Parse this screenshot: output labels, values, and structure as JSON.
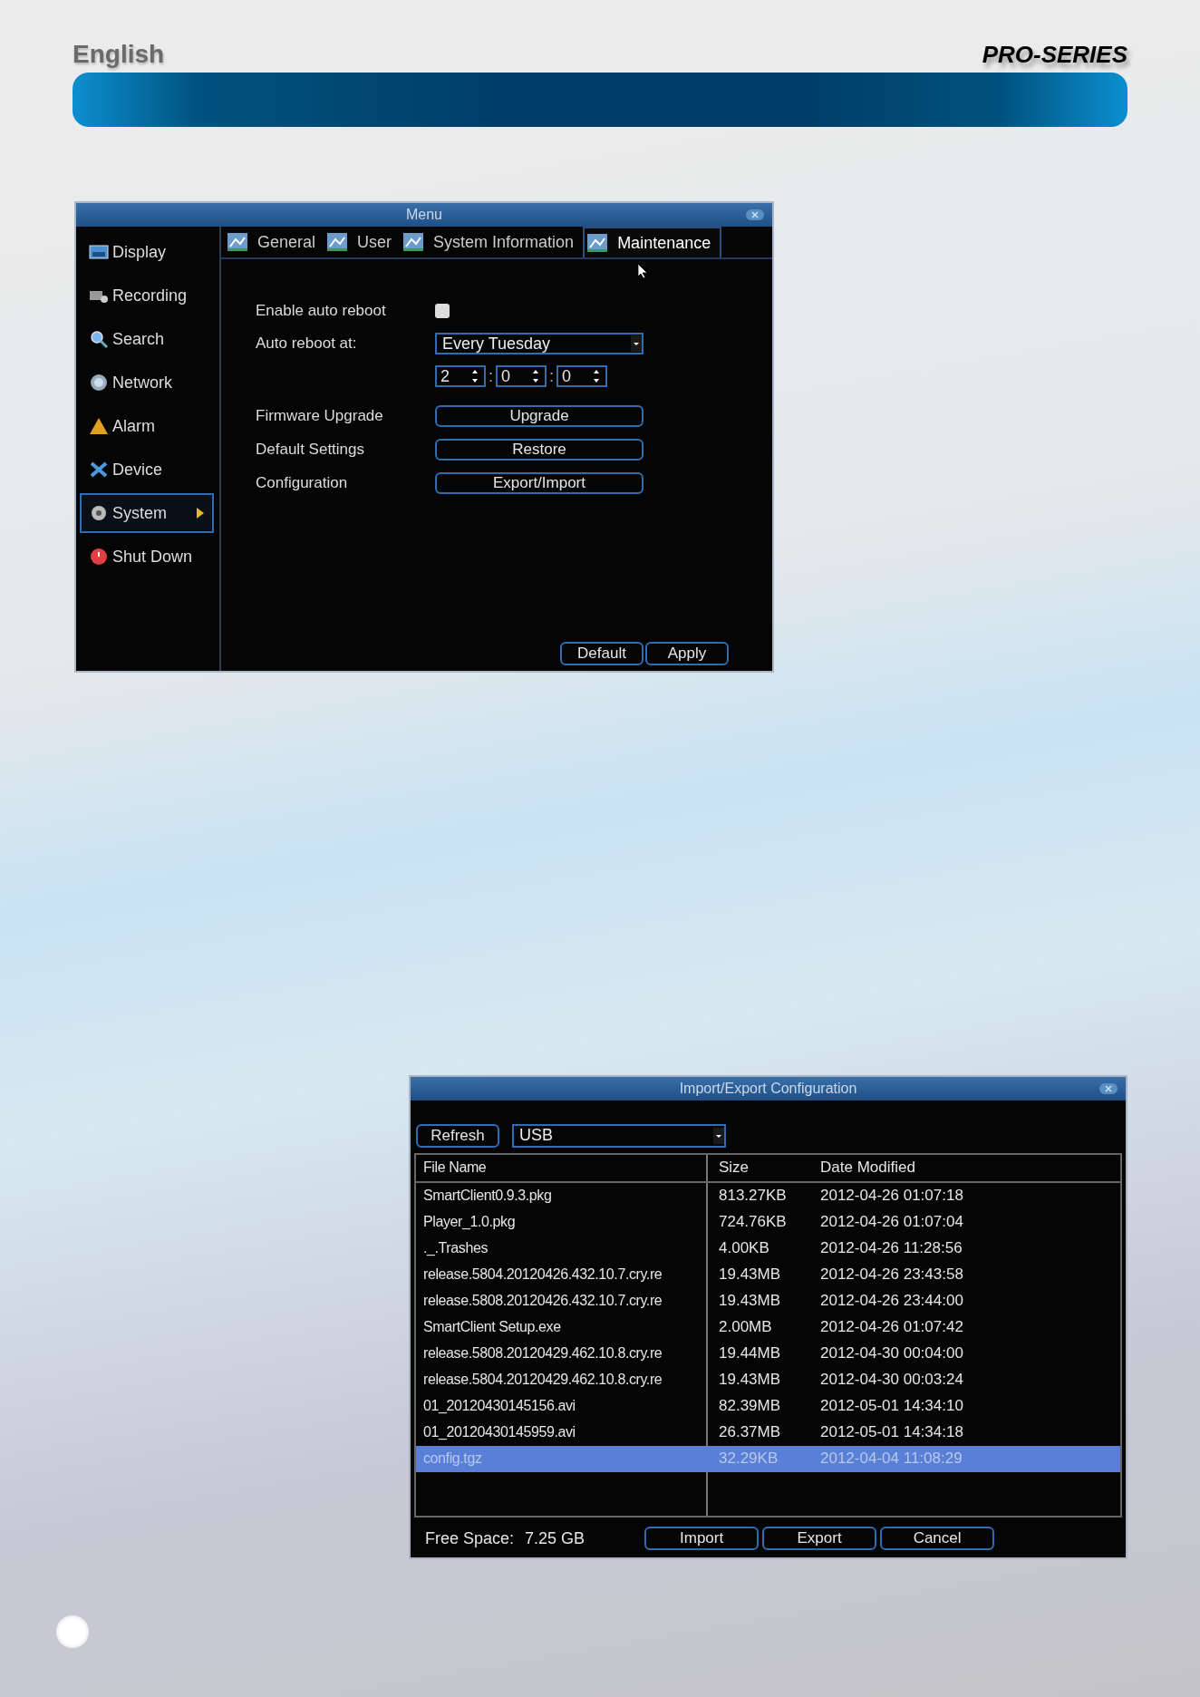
{
  "page_header": {
    "language": "English",
    "brand": "PRO-SERIES"
  },
  "menu_window": {
    "title": "Menu",
    "sidebar": [
      {
        "label": "Display",
        "selected": false
      },
      {
        "label": "Recording",
        "selected": false
      },
      {
        "label": "Search",
        "selected": false
      },
      {
        "label": "Network",
        "selected": false
      },
      {
        "label": "Alarm",
        "selected": false
      },
      {
        "label": "Device",
        "selected": false
      },
      {
        "label": "System",
        "selected": true
      },
      {
        "label": "Shut Down",
        "selected": false
      }
    ],
    "tabs": [
      {
        "label": "General",
        "selected": false
      },
      {
        "label": "User",
        "selected": false
      },
      {
        "label": "System Information",
        "selected": false
      },
      {
        "label": "Maintenance",
        "selected": true
      }
    ],
    "enable_auto_reboot": {
      "label": "Enable auto reboot",
      "checked": false
    },
    "auto_reboot_at": {
      "label": "Auto reboot at:",
      "value": "Every Tuesday",
      "time": [
        "2",
        "0",
        "0"
      ],
      "separator": ":"
    },
    "actions": [
      {
        "label": "Firmware Upgrade",
        "button": "Upgrade"
      },
      {
        "label": "Default Settings",
        "button": "Restore"
      },
      {
        "label": "Configuration",
        "button": "Export/Import"
      }
    ],
    "buttons": [
      "Default",
      "Apply"
    ]
  },
  "import_export_dialog": {
    "title": "Import/Export Configuration",
    "refresh": "Refresh",
    "device": "USB",
    "table": {
      "columns": [
        "File Name",
        "Size",
        "Date Modified"
      ],
      "rows": [
        {
          "cells": [
            "SmartClient0.9.3.pkg",
            "813.27KB",
            "2012-04-26 01:07:18"
          ],
          "selected": false
        },
        {
          "cells": [
            "Player_1.0.pkg",
            "724.76KB",
            "2012-04-26 01:07:04"
          ],
          "selected": false
        },
        {
          "cells": [
            "._.Trashes",
            "4.00KB",
            "2012-04-26 11:28:56"
          ],
          "selected": false
        },
        {
          "cells": [
            "release.5804.20120426.432.10.7.cry.re",
            "19.43MB",
            "2012-04-26 23:43:58"
          ],
          "selected": false
        },
        {
          "cells": [
            "release.5808.20120426.432.10.7.cry.re",
            "19.43MB",
            "2012-04-26 23:44:00"
          ],
          "selected": false
        },
        {
          "cells": [
            "SmartClient Setup.exe",
            "2.00MB",
            "2012-04-26 01:07:42"
          ],
          "selected": false
        },
        {
          "cells": [
            "release.5808.20120429.462.10.8.cry.re",
            "19.44MB",
            "2012-04-30 00:04:00"
          ],
          "selected": false
        },
        {
          "cells": [
            "release.5804.20120429.462.10.8.cry.re",
            "19.43MB",
            "2012-04-30 00:03:24"
          ],
          "selected": false
        },
        {
          "cells": [
            "01_20120430145156.avi",
            "82.39MB",
            "2012-05-01 14:34:10"
          ],
          "selected": false
        },
        {
          "cells": [
            "01_20120430145959.avi",
            "26.37MB",
            "2012-05-01 14:34:18"
          ],
          "selected": false
        },
        {
          "cells": [
            "config.tgz",
            "32.29KB",
            "2012-04-04 11:08:29"
          ],
          "selected": true
        }
      ]
    },
    "free_space_label": "Free Space:",
    "free_space": "7.25 GB",
    "buttons": [
      "Import",
      "Export",
      "Cancel"
    ]
  }
}
